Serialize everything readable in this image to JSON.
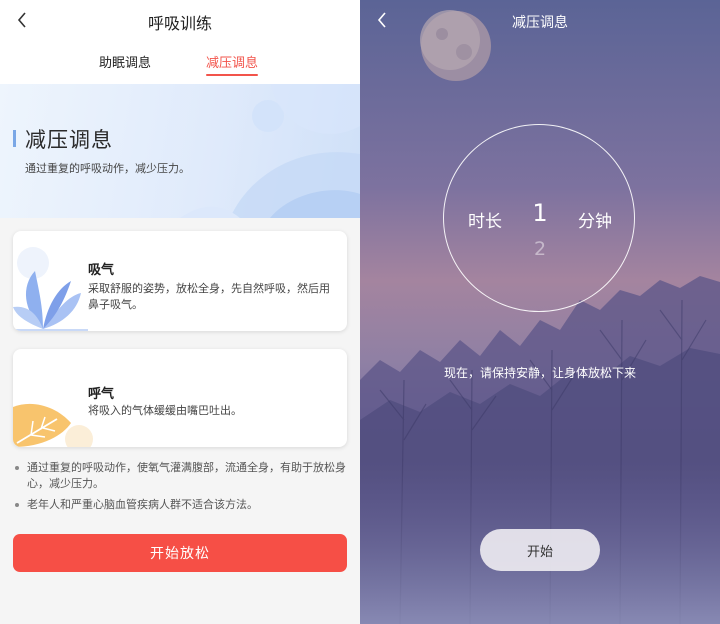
{
  "left_screen": {
    "nav": {
      "title": "呼吸训练"
    },
    "tabs": [
      {
        "label": "助眠调息",
        "active": false
      },
      {
        "label": "减压调息",
        "active": true
      }
    ],
    "banner": {
      "title": "减压调息",
      "subtitle": "通过重复的呼吸动作，减少压力。"
    },
    "cards": [
      {
        "title": "吸气",
        "description": "采取舒服的姿势，放松全身，先自然呼吸，然后用鼻子吸气。",
        "art_icon": "lotus-icon"
      },
      {
        "title": "呼气",
        "description": "将吸入的气体缓缓由嘴巴吐出。",
        "art_icon": "leaf-icon"
      }
    ],
    "notes": [
      "通过重复的呼吸动作，使氧气灌满腹部，流通全身，有助于放松身心，减少压力。",
      "老年人和严重心脑血管疾病人群不适合该方法。"
    ],
    "start_button": "开始放松"
  },
  "right_screen": {
    "title": "减压调息",
    "duration": {
      "label": "时长",
      "value": "1",
      "next_value": "2",
      "unit": "分钟"
    },
    "hint": "现在，请保持安静，让身体放松下来",
    "start_button": "开始"
  },
  "colors": {
    "accent": "#f64f46",
    "tab_active": "#f2544b",
    "banner_accent": "#7aa7e6"
  }
}
